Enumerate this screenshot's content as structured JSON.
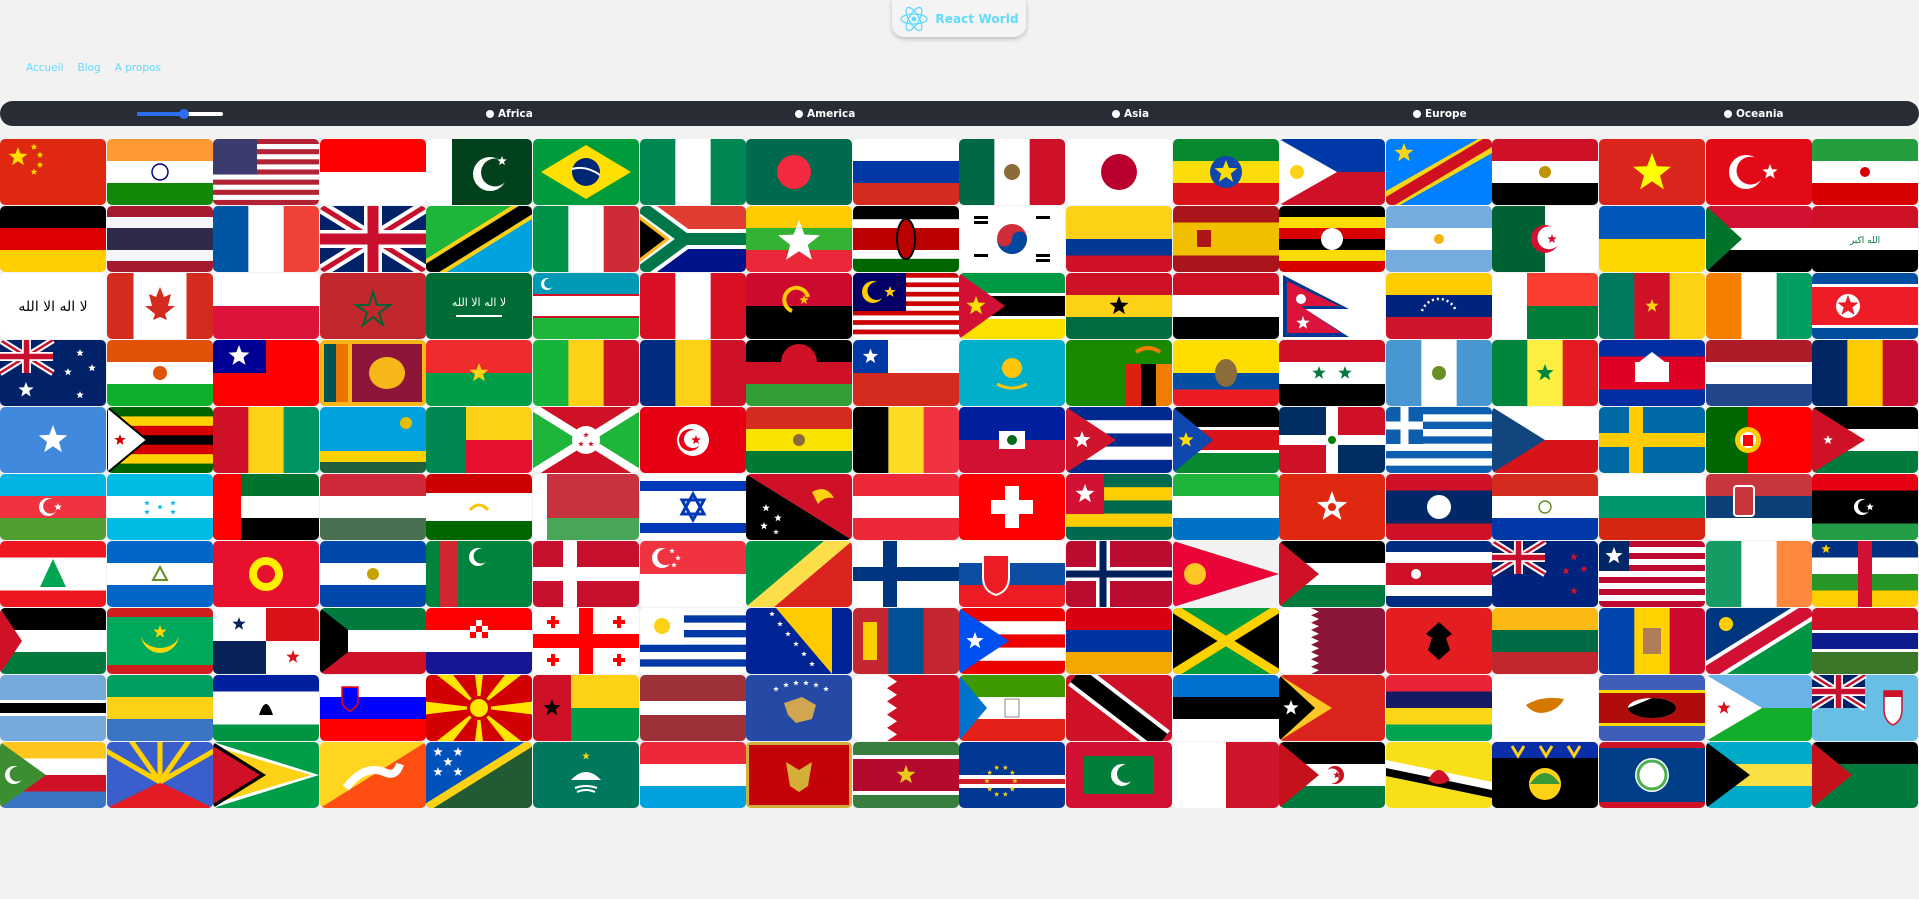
{
  "app": {
    "title": "React World",
    "logo_icon": "react-atom-icon",
    "accent_color": "#61dafb",
    "background_color": "#f2f2f2"
  },
  "nav": {
    "links": [
      {
        "label": "Accueil"
      },
      {
        "label": "Blog"
      },
      {
        "label": "A propos"
      }
    ]
  },
  "filters": {
    "bar_color": "#282c34",
    "slider": {
      "value_fraction": 0.55,
      "color": "#2f6df0"
    },
    "regions": [
      {
        "label": "Africa",
        "selected": false
      },
      {
        "label": "America",
        "selected": false
      },
      {
        "label": "Asia",
        "selected": false
      },
      {
        "label": "Europe",
        "selected": false
      },
      {
        "label": "Oceania",
        "selected": false
      }
    ]
  },
  "flags": [
    "china",
    "india",
    "usa",
    "indonesia",
    "pakistan",
    "brazil",
    "nigeria",
    "bangladesh",
    "russia",
    "mexico",
    "japan",
    "ethiopia",
    "philippines",
    "dr-congo",
    "egypt",
    "vietnam",
    "turkey",
    "iran",
    "germany",
    "thailand",
    "france",
    "uk",
    "tanzania",
    "italy",
    "south-africa",
    "myanmar",
    "kenya",
    "south-korea",
    "colombia",
    "spain",
    "uganda",
    "argentina",
    "algeria",
    "ukraine",
    "sudan",
    "iraq",
    "afghanistan",
    "canada",
    "poland",
    "morocco",
    "saudi-arabia",
    "uzbekistan",
    "peru",
    "angola",
    "malaysia",
    "mozambique",
    "ghana",
    "yemen",
    "nepal",
    "venezuela",
    "madagascar",
    "cameroon",
    "ivory-coast",
    "north-korea",
    "australia",
    "niger",
    "taiwan",
    "sri-lanka",
    "burkina-faso",
    "mali",
    "romania",
    "malawi",
    "chile",
    "kazakhstan",
    "zambia",
    "ecuador",
    "syria",
    "guatemala",
    "senegal",
    "cambodia",
    "netherlands",
    "chad",
    "somalia",
    "zimbabwe",
    "guinea",
    "rwanda",
    "benin",
    "burundi",
    "tunisia",
    "bolivia",
    "belgium",
    "haiti",
    "cuba",
    "south-sudan",
    "dominican-republic",
    "greece",
    "czechia",
    "sweden",
    "portugal",
    "jordan",
    "azerbaijan",
    "honduras",
    "uae",
    "hungary",
    "tajikistan",
    "belarus",
    "israel",
    "papua-new-guinea",
    "austria",
    "switzerland",
    "togo",
    "sierra-leone",
    "hong-kong",
    "laos",
    "paraguay",
    "bulgaria",
    "serbia",
    "libya",
    "lebanon",
    "nicaragua",
    "kyrgyzstan",
    "el-salvador",
    "turkmenistan",
    "denmark",
    "singapore",
    "congo",
    "finland",
    "slovakia",
    "norway",
    "eritrea",
    "palestine",
    "costa-rica",
    "new-zealand",
    "liberia",
    "ireland",
    "central-african-republic",
    "palestine-2",
    "mauritania",
    "panama",
    "kuwait",
    "croatia",
    "georgia",
    "uruguay",
    "bosnia",
    "mongolia",
    "puerto-rico",
    "armenia",
    "jamaica",
    "qatar",
    "albania",
    "lithuania",
    "moldova",
    "namibia",
    "gambia",
    "botswana",
    "gabon",
    "lesotho",
    "slovenia",
    "north-macedonia",
    "guinea-bissau",
    "latvia",
    "kosovo",
    "bahrain",
    "equatorial-guinea",
    "trinidad",
    "estonia",
    "timor-leste",
    "mauritius",
    "cyprus",
    "eswatini",
    "djibouti",
    "fiji",
    "comoros",
    "reunion",
    "guyana",
    "bhutan",
    "solomon-islands",
    "macau",
    "luxembourg",
    "montenegro",
    "suriname",
    "cape-verde",
    "maldives",
    "malta",
    "western-sahara",
    "brunei",
    "guadeloupe",
    "belize",
    "bahamas",
    "western-sahara-2"
  ]
}
